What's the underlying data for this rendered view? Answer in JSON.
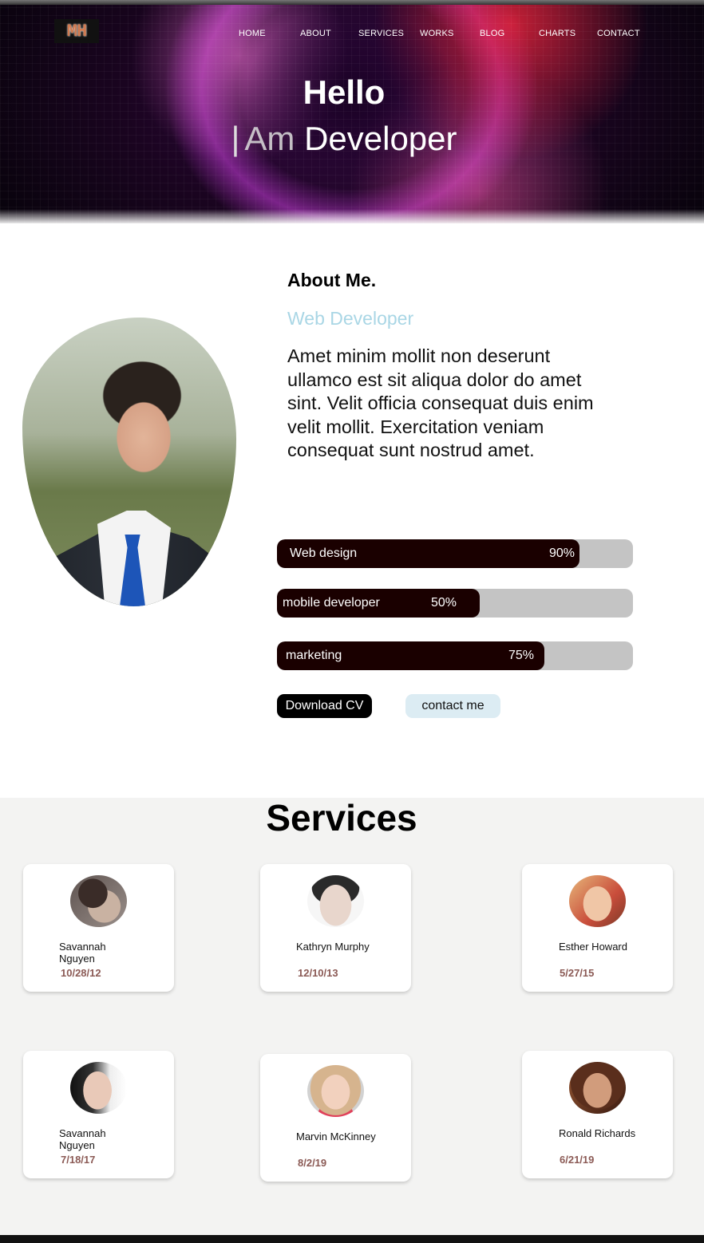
{
  "header": {
    "logo_text": "MH",
    "nav": [
      "HOME",
      "ABOUT",
      "SERVICES",
      "WORKS",
      "BLOG",
      "CHARTS",
      "CONTACT"
    ],
    "hello": "Hello",
    "cursor": "|",
    "subtitle_light": "Am",
    "subtitle_bold": "Developer"
  },
  "about": {
    "title": "About Me.",
    "role": "Web Developer",
    "text": "Amet minim mollit non deserunt ullamco est sit aliqua dolor do amet sint. Velit officia consequat duis enim velit mollit. Exercitation veniam consequat sunt nostrud amet.",
    "skills": [
      {
        "name": "Web design",
        "percent_label": "90%",
        "value": 0.85
      },
      {
        "name": "mobile developer",
        "percent_label": "50%",
        "value": 0.57
      },
      {
        "name": "marketing",
        "percent_label": "75%",
        "value": 0.75
      }
    ],
    "download_button": "Download CV",
    "contact_button": "contact me"
  },
  "services": {
    "title": "Services",
    "cards": [
      {
        "name": "Savannah\nNguyen",
        "date": "10/28/12"
      },
      {
        "name": "Kathryn Murphy",
        "date": "12/10/13"
      },
      {
        "name": "Esther Howard",
        "date": "5/27/15"
      },
      {
        "name": "Savannah\nNguyen",
        "date": "7/18/17"
      },
      {
        "name": "Marvin McKinney",
        "date": "8/2/19"
      },
      {
        "name": "Ronald Richards",
        "date": "6/21/19"
      }
    ]
  },
  "colors": {
    "skill_fill": "#1a0000",
    "skill_track": "#c4c4c4",
    "role_text": "#a9d6e5",
    "date_text": "#8b5a55",
    "services_bg": "#f3f3f2"
  }
}
